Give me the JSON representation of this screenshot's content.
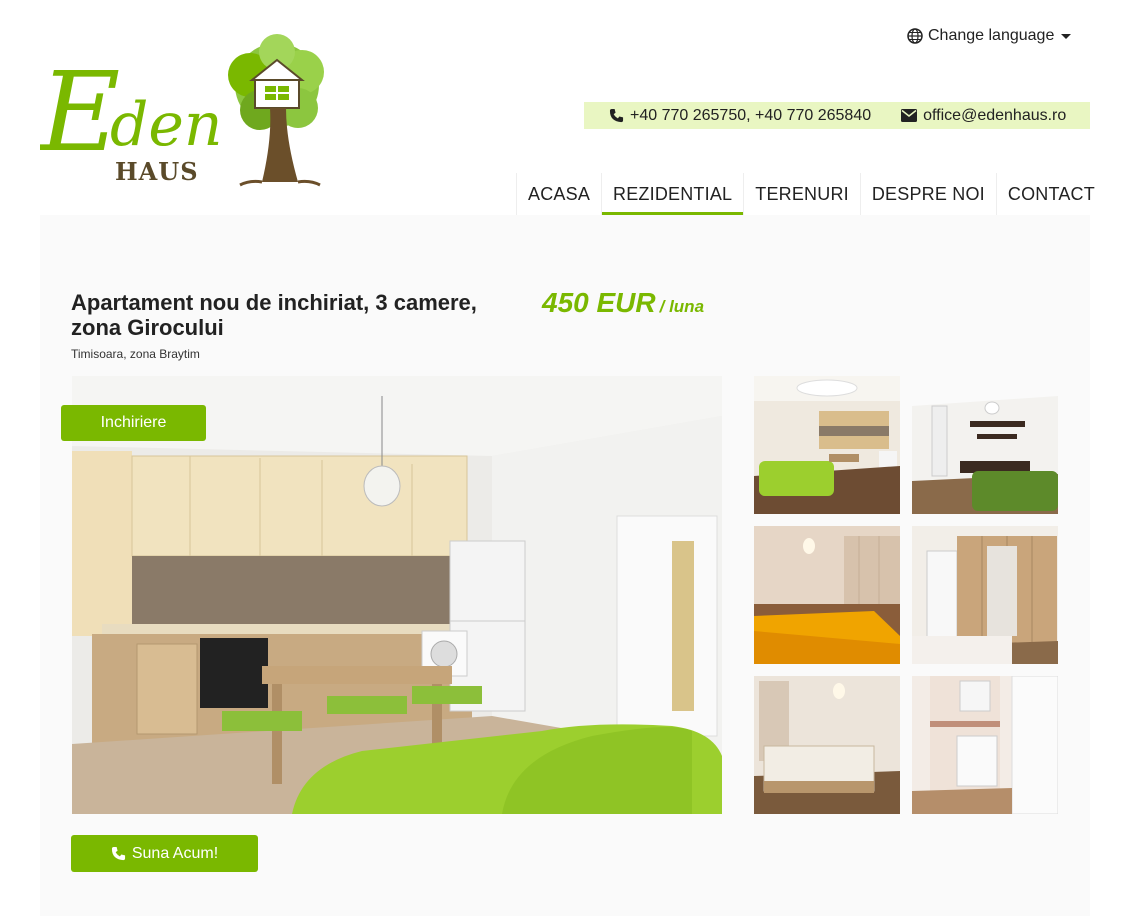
{
  "header": {
    "logo_text": "Eden HAUS",
    "language_label": "Change language",
    "phone": "+40 770 265750, +40 770 265840",
    "email": "office@edenhaus.ro"
  },
  "nav": {
    "items": [
      "ACASA",
      "REZIDENTIAL",
      "TERENURI",
      "DESPRE NOI",
      "CONTACT"
    ],
    "active": "REZIDENTIAL"
  },
  "listing": {
    "title": "Apartament nou de inchiriat, 3 camere, zona Girocului",
    "location": "Timisoara, zona Braytim",
    "price": "450 EUR",
    "price_period": "/ luna",
    "badge": "Inchiriere",
    "call_button": "Suna Acum!"
  },
  "colors": {
    "accent": "#7ab800",
    "contact_bar": "#e9f6c2"
  },
  "icons": [
    "globe-icon",
    "caret-down-icon",
    "phone-icon",
    "envelope-icon"
  ]
}
